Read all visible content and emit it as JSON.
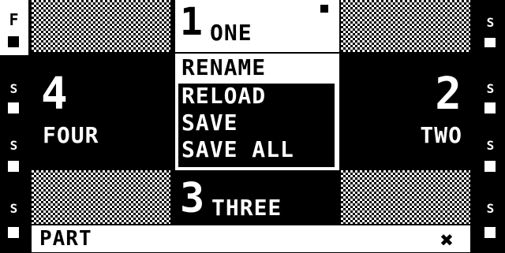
{
  "top_slot": {
    "number": "1",
    "name": "ONE"
  },
  "right_slot": {
    "number": "2",
    "name": "TWO"
  },
  "bottom_slot": {
    "number": "3",
    "name": "THREE"
  },
  "left_slot": {
    "number": "4",
    "name": "FOUR"
  },
  "menu": {
    "items": [
      {
        "label": "RENAME"
      },
      {
        "label": "RELOAD"
      },
      {
        "label": "SAVE"
      },
      {
        "label": "SAVE ALL"
      }
    ],
    "highlighted_index": 0
  },
  "status": {
    "mode_label": "PART"
  },
  "left_strip": {
    "top_label": "F",
    "marks": [
      "S",
      "S",
      "S"
    ]
  },
  "right_strip": {
    "marks": [
      "S",
      "S",
      "S",
      "S",
      "S"
    ]
  },
  "colors": {
    "foreground": "#ffffff",
    "background": "#000000"
  }
}
